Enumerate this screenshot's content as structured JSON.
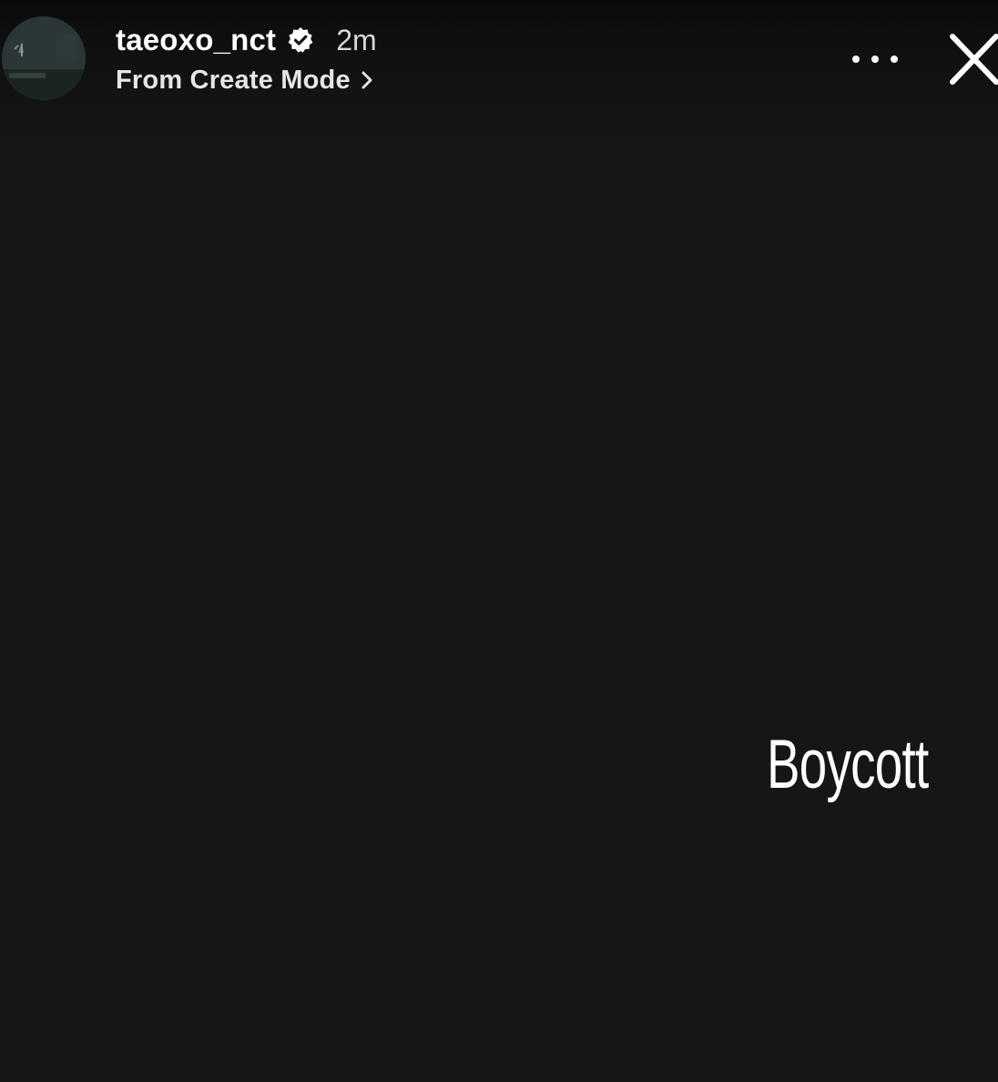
{
  "header": {
    "username": "taeoxo_nct",
    "verified_icon": "verified-badge-icon",
    "time_ago": "2m",
    "subtitle": "From Create Mode",
    "subtitle_chevron_icon": "chevron-right-icon",
    "more_icon": "more-options-icon",
    "close_icon": "close-icon"
  },
  "story": {
    "text": "Boycott",
    "background_color": "#161617",
    "text_color": "#ffffff"
  }
}
